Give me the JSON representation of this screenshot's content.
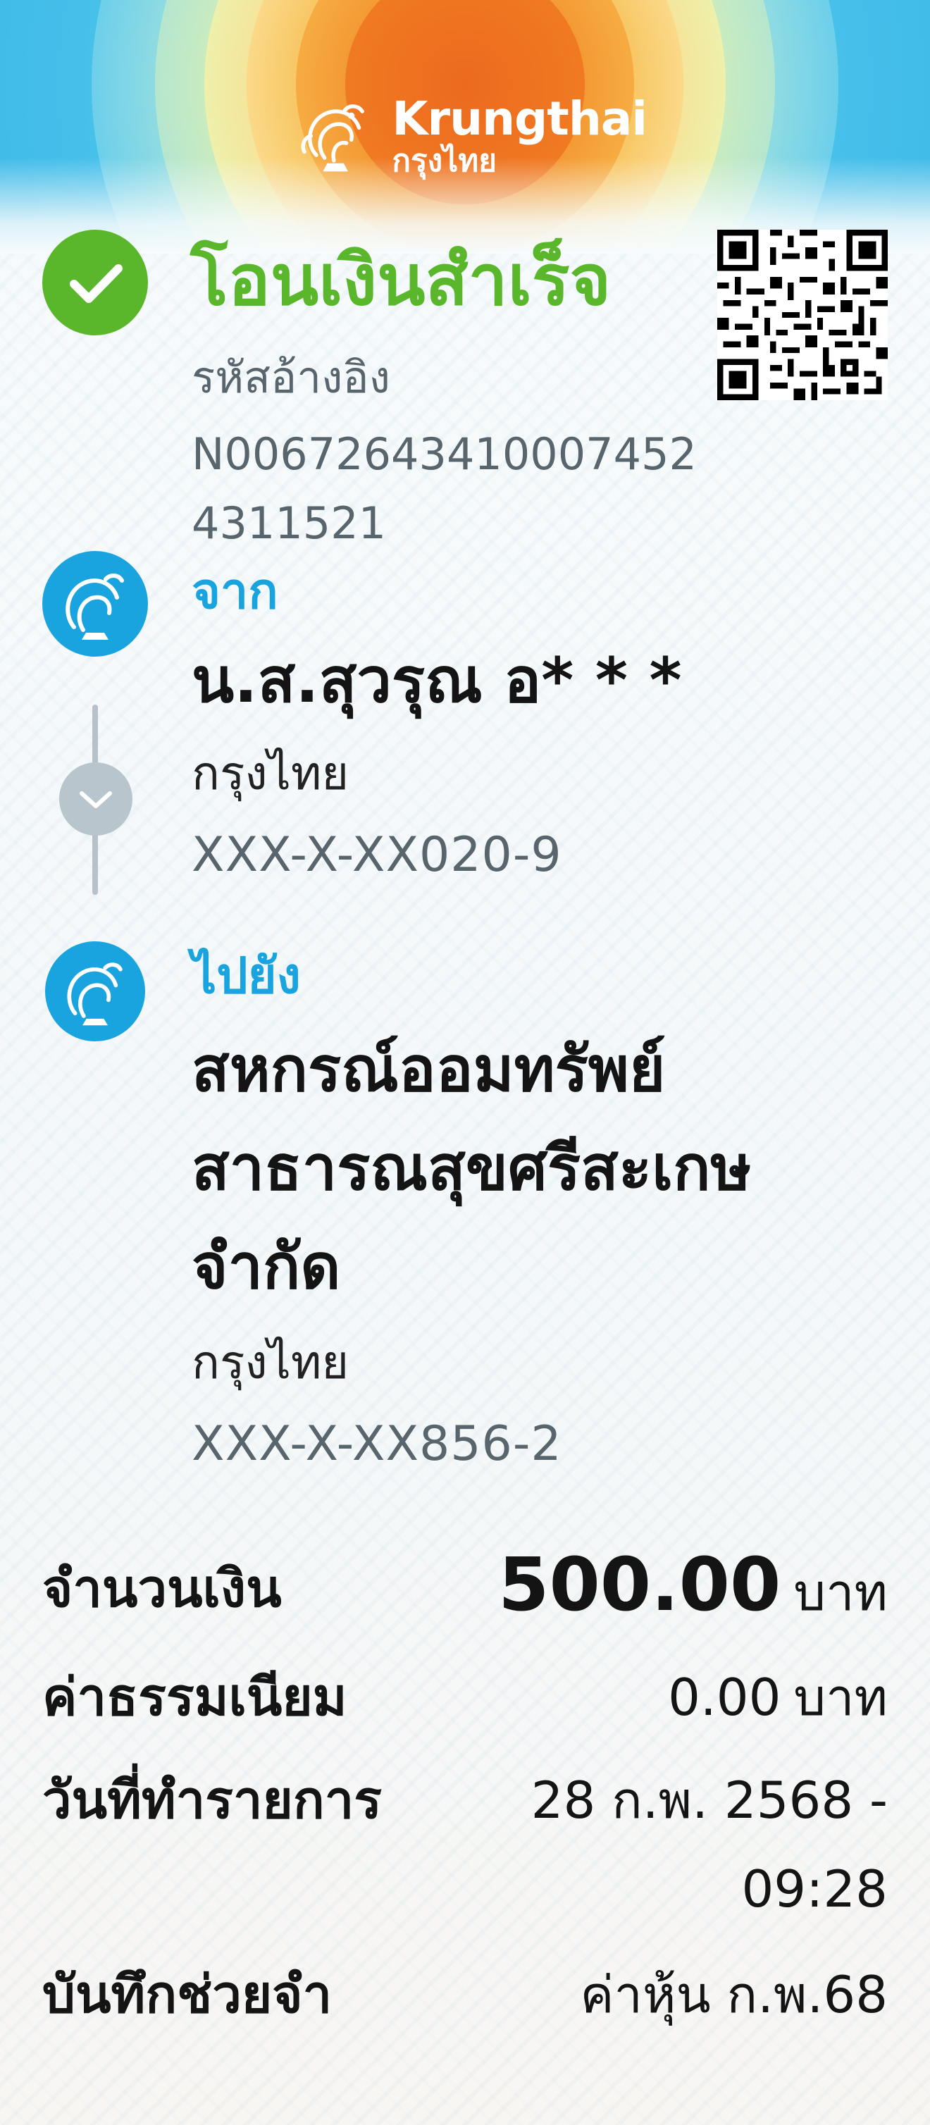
{
  "brand": {
    "name_en": "Krungthai",
    "name_th": "กรุงไทย"
  },
  "status": {
    "title": "โอนเงินสำเร็จ",
    "icon": "check-icon",
    "color": "#5ab72b"
  },
  "reference": {
    "label": "รหัสอ้างอิง",
    "number": "N006726434100074524311521"
  },
  "from": {
    "label": "จาก",
    "name": "น.ส.สุวรุณ อ* * *",
    "bank": "กรุงไทย",
    "account": "XXX-X-XX020-9"
  },
  "to": {
    "label": "ไปยัง",
    "name": "สหกรณ์ออมทรัพย์สาธารณสุขศรีสะเกษจำกัด",
    "bank": "กรุงไทย",
    "account": "XXX-X-XX856-2"
  },
  "summary": {
    "amount_label": "จำนวนเงิน",
    "amount_value": "500.00",
    "amount_unit": "บาท",
    "fee_label": "ค่าธรรมเนียม",
    "fee_value": "0.00",
    "fee_unit": "บาท",
    "date_label": "วันที่ทำรายการ",
    "date_value": "28 ก.พ. 2568 -",
    "time_value": "09:28",
    "memo_label": "บันทึกช่วยจำ",
    "memo_value": "ค่าหุ้น ก.พ.68"
  },
  "colors": {
    "accent_blue": "#19a4e0",
    "success_green": "#5ab72b",
    "muted_gray": "#59656d"
  }
}
